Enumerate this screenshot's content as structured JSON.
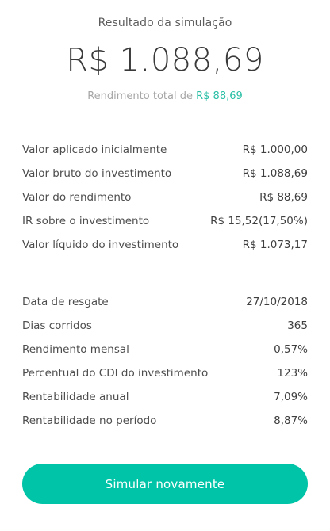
{
  "header": {
    "subtitle": "Resultado da simulação",
    "total": "R$ 1.088,69",
    "yield_label": "Rendimento total de",
    "yield_value": "R$ 88,69"
  },
  "investment": [
    {
      "label": "Valor aplicado inicialmente",
      "value": "R$ 1.000,00"
    },
    {
      "label": "Valor bruto do investimento",
      "value": "R$ 1.088,69"
    },
    {
      "label": "Valor do rendimento",
      "value": "R$ 88,69"
    },
    {
      "label": "IR sobre o investimento",
      "value": "R$ 15,52(17,50%)"
    },
    {
      "label": "Valor líquido do investimento",
      "value": "R$ 1.073,17"
    }
  ],
  "details": [
    {
      "label": "Data de resgate",
      "value": "27/10/2018"
    },
    {
      "label": "Dias corridos",
      "value": "365"
    },
    {
      "label": "Rendimento mensal",
      "value": "0,57%"
    },
    {
      "label": "Percentual do CDI do investimento",
      "value": "123%"
    },
    {
      "label": "Rentabilidade anual",
      "value": "7,09%"
    },
    {
      "label": "Rentabilidade no período",
      "value": "8,87%"
    }
  ],
  "actions": {
    "simulate_again_label": "Simular novamente"
  },
  "colors": {
    "accent": "#00c4a7",
    "accent_text": "#2bbfa6"
  }
}
